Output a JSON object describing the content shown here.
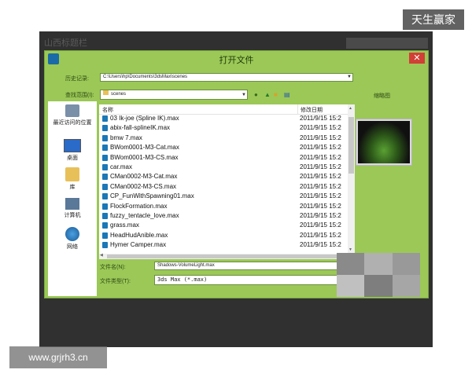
{
  "app": {
    "title": "山西标题栏"
  },
  "dialog": {
    "title": "打开文件",
    "close_label": "✕",
    "history_label": "历史记录:",
    "history_value": "C:\\Users\\hp\\Documents\\3dsMax\\scenes",
    "lookin_label": "查找范围(I):",
    "lookin_value": "scenes",
    "thumbnail_label": "缩略图"
  },
  "places": [
    {
      "label": "最近访问的位置",
      "icon": "recent-places-icon"
    },
    {
      "label": "桌面",
      "icon": "desktop-icon"
    },
    {
      "label": "库",
      "icon": "libraries-icon"
    },
    {
      "label": "计算机",
      "icon": "computer-icon"
    },
    {
      "label": "网络",
      "icon": "network-icon"
    }
  ],
  "file_list": {
    "col_name": "名称",
    "col_date": "修改日期",
    "rows": [
      {
        "name": "03 Ik-joe (Spline IK).max",
        "date": "2011/9/15 15:2"
      },
      {
        "name": "abix-fall-splineIK.max",
        "date": "2011/9/15 15:2"
      },
      {
        "name": "bmw 7.max",
        "date": "2011/9/15 15:2"
      },
      {
        "name": "BWom0001-M3-Cat.max",
        "date": "2011/9/15 15:2"
      },
      {
        "name": "BWom0001-M3-CS.max",
        "date": "2011/9/15 15:2"
      },
      {
        "name": "car.max",
        "date": "2011/9/15 15:2"
      },
      {
        "name": "CMan0002-M3-Cat.max",
        "date": "2011/9/15 15:2"
      },
      {
        "name": "CMan0002-M3-CS.max",
        "date": "2011/9/15 15:2"
      },
      {
        "name": "CP_FunWithSpawning01.max",
        "date": "2011/9/15 15:2"
      },
      {
        "name": "FlockFormation.max",
        "date": "2011/9/15 15:2"
      },
      {
        "name": "fuzzy_tentacle_love.max",
        "date": "2011/9/15 15:2"
      },
      {
        "name": "grass.max",
        "date": "2011/9/15 15:2"
      },
      {
        "name": "HeadHudAnible.max",
        "date": "2011/9/15 15:2"
      },
      {
        "name": "Hymer Camper.max",
        "date": "2011/9/15 15:2"
      }
    ]
  },
  "filename": {
    "label": "文件名(N):",
    "value": "Shadows-VolumeLight.max"
  },
  "filetype": {
    "label": "文件类型(T):",
    "value": "3ds Max (*.max)"
  },
  "watermarks": {
    "top_right": "天生赢家",
    "bottom_left": "www.grjrh3.cn"
  },
  "colors": {
    "dialog_bg": "#9bc857",
    "close_red": "#d13f36",
    "file_icon_blue": "#1a78b7"
  }
}
